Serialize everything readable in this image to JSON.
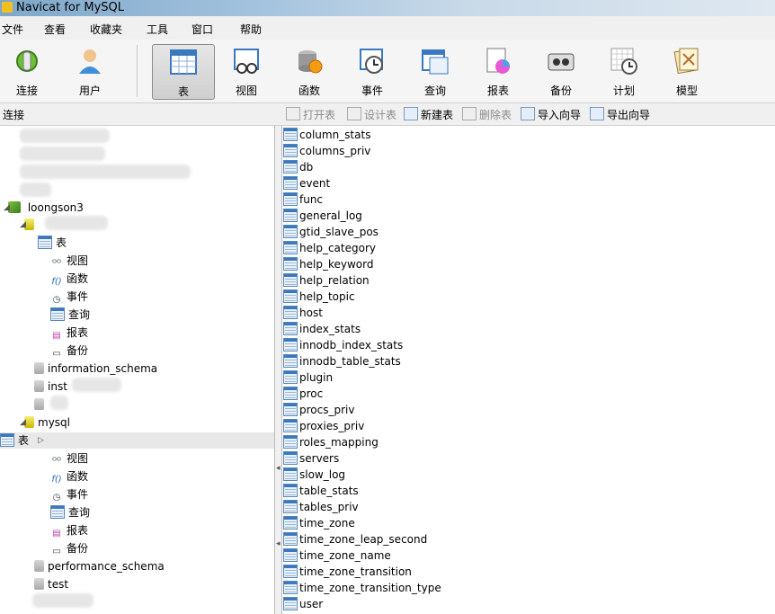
{
  "window": {
    "title": "Navicat for MySQL"
  },
  "menu": [
    "文件",
    "查看",
    "收藏夹",
    "工具",
    "窗口",
    "帮助"
  ],
  "toolbar": {
    "buttons": [
      {
        "label": "连接",
        "icon": "connection-icon"
      },
      {
        "label": "用户",
        "icon": "user-icon"
      },
      {
        "label": "表",
        "icon": "table-icon"
      },
      {
        "label": "视图",
        "icon": "view-icon"
      },
      {
        "label": "函数",
        "icon": "function-icon"
      },
      {
        "label": "事件",
        "icon": "event-icon"
      },
      {
        "label": "查询",
        "icon": "query-icon"
      },
      {
        "label": "报表",
        "icon": "report-icon"
      },
      {
        "label": "备份",
        "icon": "backup-icon"
      },
      {
        "label": "计划",
        "icon": "schedule-icon"
      },
      {
        "label": "模型",
        "icon": "model-icon"
      }
    ],
    "active": "表"
  },
  "subbar": {
    "connections_label": "连接",
    "actions": {
      "open": "打开表",
      "design": "设计表",
      "new": "新建表",
      "delete": "删除表",
      "import": "导入向导",
      "export": "导出向导"
    }
  },
  "tree": {
    "connection": "loongson3",
    "db_categories": {
      "tables": "表",
      "views": "视图",
      "functions": "函数",
      "events": "事件",
      "queries": "查询",
      "reports": "报表",
      "backups": "备份"
    },
    "databases": {
      "information_schema": "information_schema",
      "inst": "inst",
      "mysql": "mysql",
      "performance_schema": "performance_schema",
      "test": "test"
    }
  },
  "tables": [
    "column_stats",
    "columns_priv",
    "db",
    "event",
    "func",
    "general_log",
    "gtid_slave_pos",
    "help_category",
    "help_keyword",
    "help_relation",
    "help_topic",
    "host",
    "index_stats",
    "innodb_index_stats",
    "innodb_table_stats",
    "plugin",
    "proc",
    "procs_priv",
    "proxies_priv",
    "roles_mapping",
    "servers",
    "slow_log",
    "table_stats",
    "tables_priv",
    "time_zone",
    "time_zone_leap_second",
    "time_zone_name",
    "time_zone_transition",
    "time_zone_transition_type",
    "user"
  ]
}
